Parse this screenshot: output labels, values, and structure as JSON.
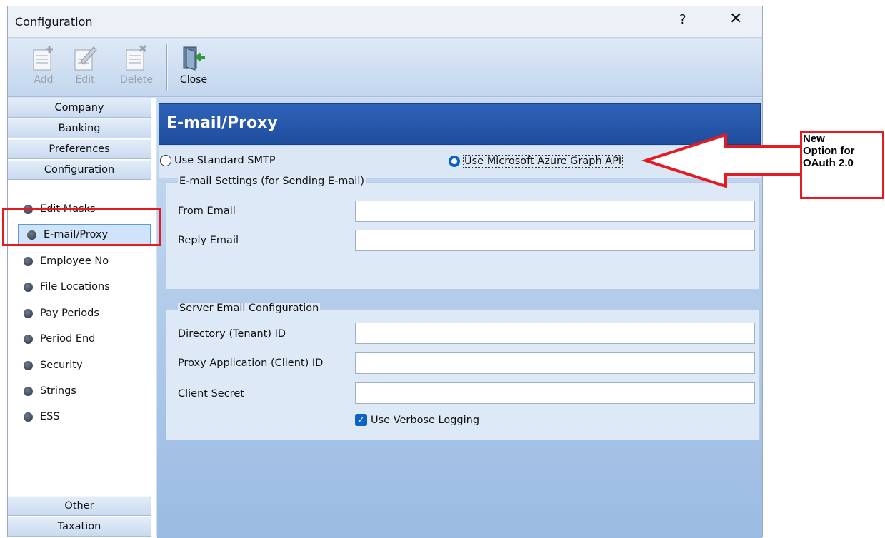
{
  "window": {
    "title": "Configuration",
    "help_glyph": "?",
    "close_glyph": "✕"
  },
  "toolbar": {
    "add_label": "Add",
    "edit_label": "Edit",
    "delete_label": "Delete",
    "close_label": "Close"
  },
  "sidebar": {
    "categories_top": [
      "Company",
      "Banking",
      "Preferences",
      "Configuration"
    ],
    "items": [
      "Edit Masks",
      "E-mail/Proxy",
      "Employee No",
      "File Locations",
      "Pay Periods",
      "Period End",
      "Security",
      "Strings",
      "ESS"
    ],
    "selected_item": "E-mail/Proxy",
    "categories_bottom": [
      "Other",
      "Taxation"
    ]
  },
  "main": {
    "header_title": "E-mail/Proxy",
    "radio_standard": "Use Standard SMTP",
    "radio_azure": "Use Microsoft Azure Graph API",
    "selected_radio": "Use Microsoft Azure Graph API",
    "email_group": {
      "title": "E-mail Settings (for Sending E-mail)",
      "from_label": "From Email",
      "from_value": "",
      "reply_label": "Reply Email",
      "reply_value": ""
    },
    "server_group": {
      "title": "Server Email Configuration",
      "tenant_label": "Directory (Tenant) ID",
      "tenant_value": "",
      "client_label": "Proxy Application (Client) ID",
      "client_value": "",
      "secret_label": "Client Secret",
      "secret_value": "",
      "verbose_label": "Use Verbose Logging",
      "verbose_checked": true
    }
  },
  "annotation": {
    "line1": "New",
    "line2": "Option for",
    "line3": "OAuth 2.0",
    "color": "#e31b23"
  }
}
